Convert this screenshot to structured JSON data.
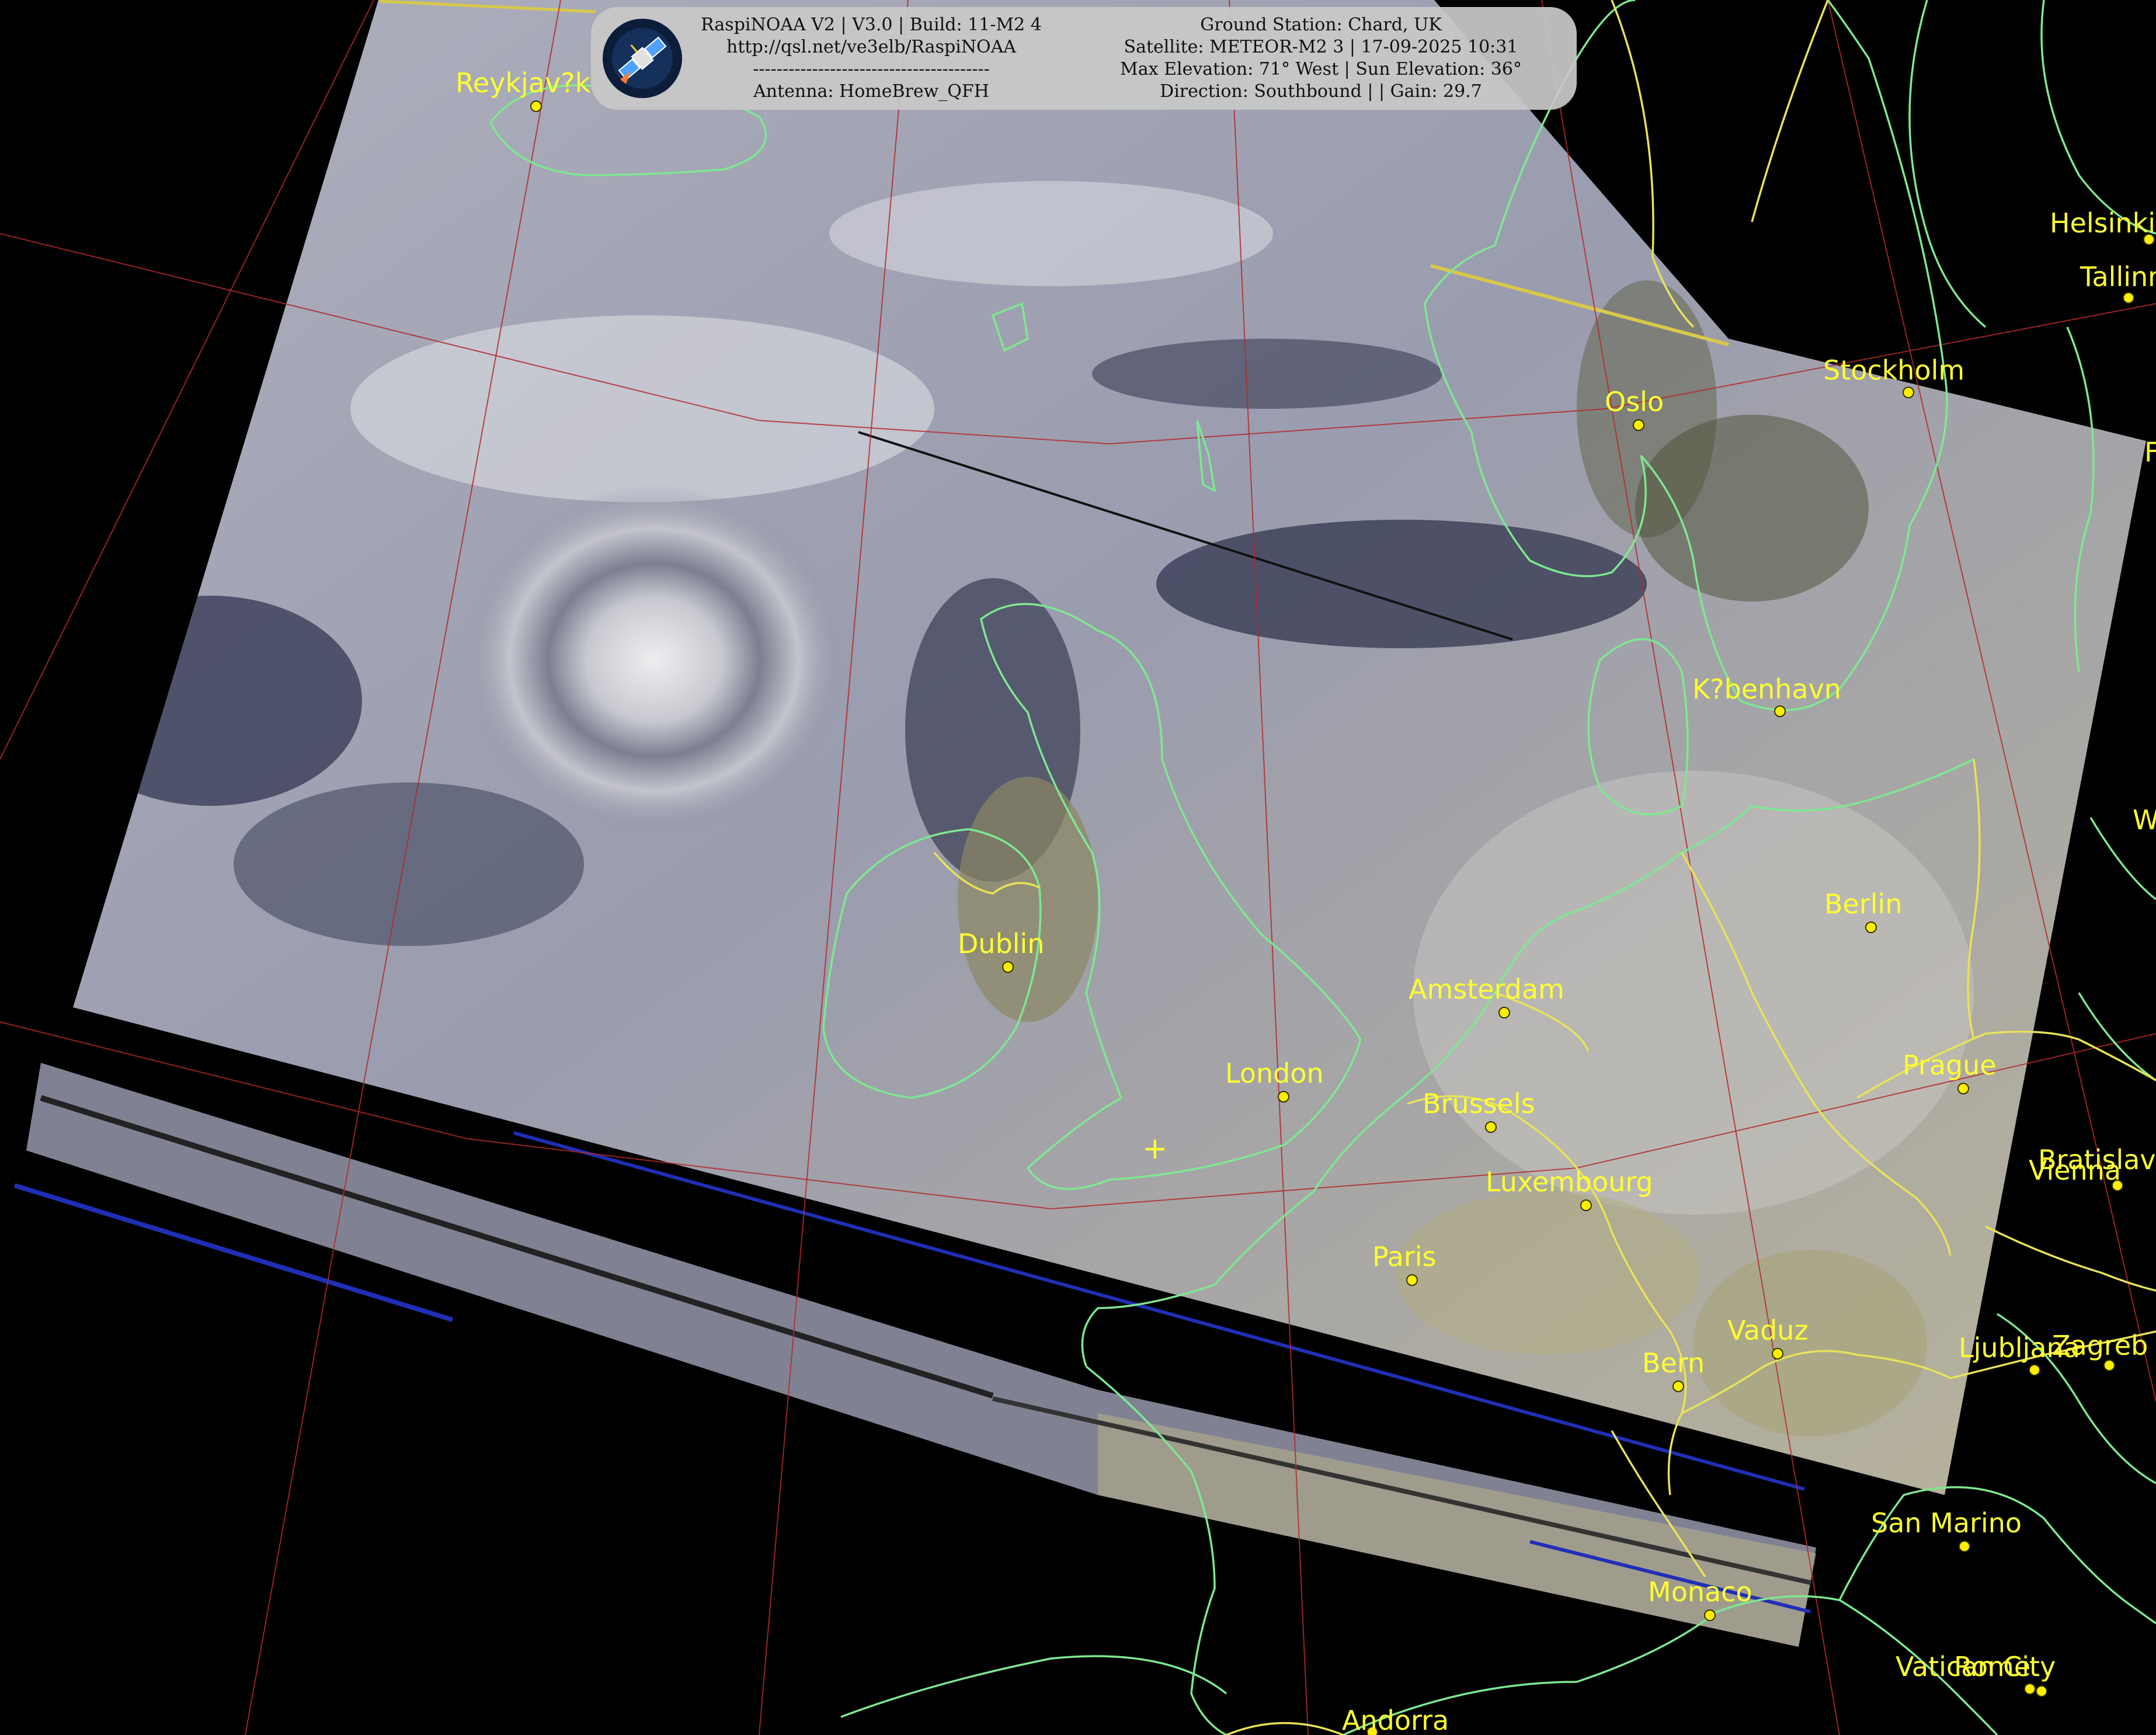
{
  "header": {
    "left_lines": [
      "RaspiNOAA V2 | V3.0 | Build: 11-M2 4",
      "http://qsl.net/ve3elb/RaspiNOAA",
      "----------------------------------------",
      "Antenna: HomeBrew_QFH"
    ],
    "right_lines": [
      "Ground Station: Chard, UK",
      "Satellite: METEOR-M2 3 | 17-09-2025 10:31",
      "Max Elevation: 71° West | Sun Elevation: 36°",
      "Direction: Southbound | | Gain: 29.7"
    ],
    "logo_icon": "satellite-icon"
  },
  "cities": [
    {
      "name": "Reykjav?k"
    },
    {
      "name": "Helsinki"
    },
    {
      "name": "Tallinn"
    },
    {
      "name": "Stockholm"
    },
    {
      "name": "Oslo"
    },
    {
      "name": "K?benhavn"
    },
    {
      "name": "Berlin"
    },
    {
      "name": "Dublin"
    },
    {
      "name": "Amsterdam"
    },
    {
      "name": "London"
    },
    {
      "name": "Brussels"
    },
    {
      "name": "Prague"
    },
    {
      "name": "Luxembourg"
    },
    {
      "name": "Vienna"
    },
    {
      "name": "Bratislava"
    },
    {
      "name": "Paris"
    },
    {
      "name": "Vaduz"
    },
    {
      "name": "Bern"
    },
    {
      "name": "Ljubljana"
    },
    {
      "name": "Zagreb"
    },
    {
      "name": "San Marino"
    },
    {
      "name": "Monaco"
    },
    {
      "name": "Vatican City"
    },
    {
      "name": "Rome"
    },
    {
      "name": "Andorra"
    },
    {
      "name": "W"
    },
    {
      "name": "F"
    }
  ],
  "station_marker": "+",
  "colors": {
    "label": "#ffff33",
    "coastline": "#7ee890",
    "border": "#e8e25a",
    "graticule": "#b32a2a",
    "background": "#000000"
  }
}
